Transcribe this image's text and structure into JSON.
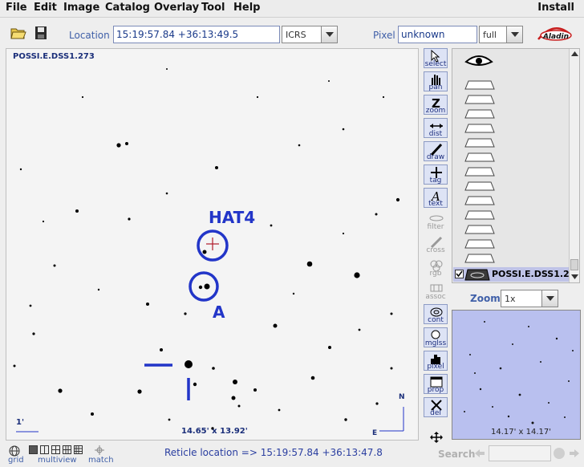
{
  "menu": [
    "File",
    "Edit",
    "Image",
    "Catalog",
    "Overlay",
    "Tool",
    "Help"
  ],
  "menu_right": "Install",
  "toolbar": {
    "location_label": "Location",
    "location_value": "15:19:57.84 +36:13:49.5",
    "frame": "ICRS",
    "pixel_label": "Pixel",
    "pixel_value": "unknown",
    "pixel_mode": "full"
  },
  "view": {
    "survey": "POSSI.E.DSS1.273",
    "fov": "14.65' x 13.92'",
    "scale": "1'",
    "labels": {
      "target": "HAT4",
      "companion": "A"
    },
    "compass": {
      "north": "N",
      "east": "E"
    }
  },
  "tools": [
    "select",
    "pan",
    "zoom",
    "dist",
    "draw",
    "tag",
    "text",
    "filter",
    "cross",
    "rgb",
    "assoc",
    "cont",
    "mglss",
    "pixel",
    "prop",
    "del"
  ],
  "stack": {
    "layer_name": "POSSI.E.DSS1.27"
  },
  "zoom": {
    "label": "Zoom",
    "value": "1x"
  },
  "preview": {
    "fov": "14.17' x 14.17'"
  },
  "bottom": {
    "grid": "grid",
    "multiview": "multiview",
    "match": "match",
    "reticle": "Reticle location => 15:19:57.84 +36:13:47.8",
    "search_label": "Search"
  }
}
